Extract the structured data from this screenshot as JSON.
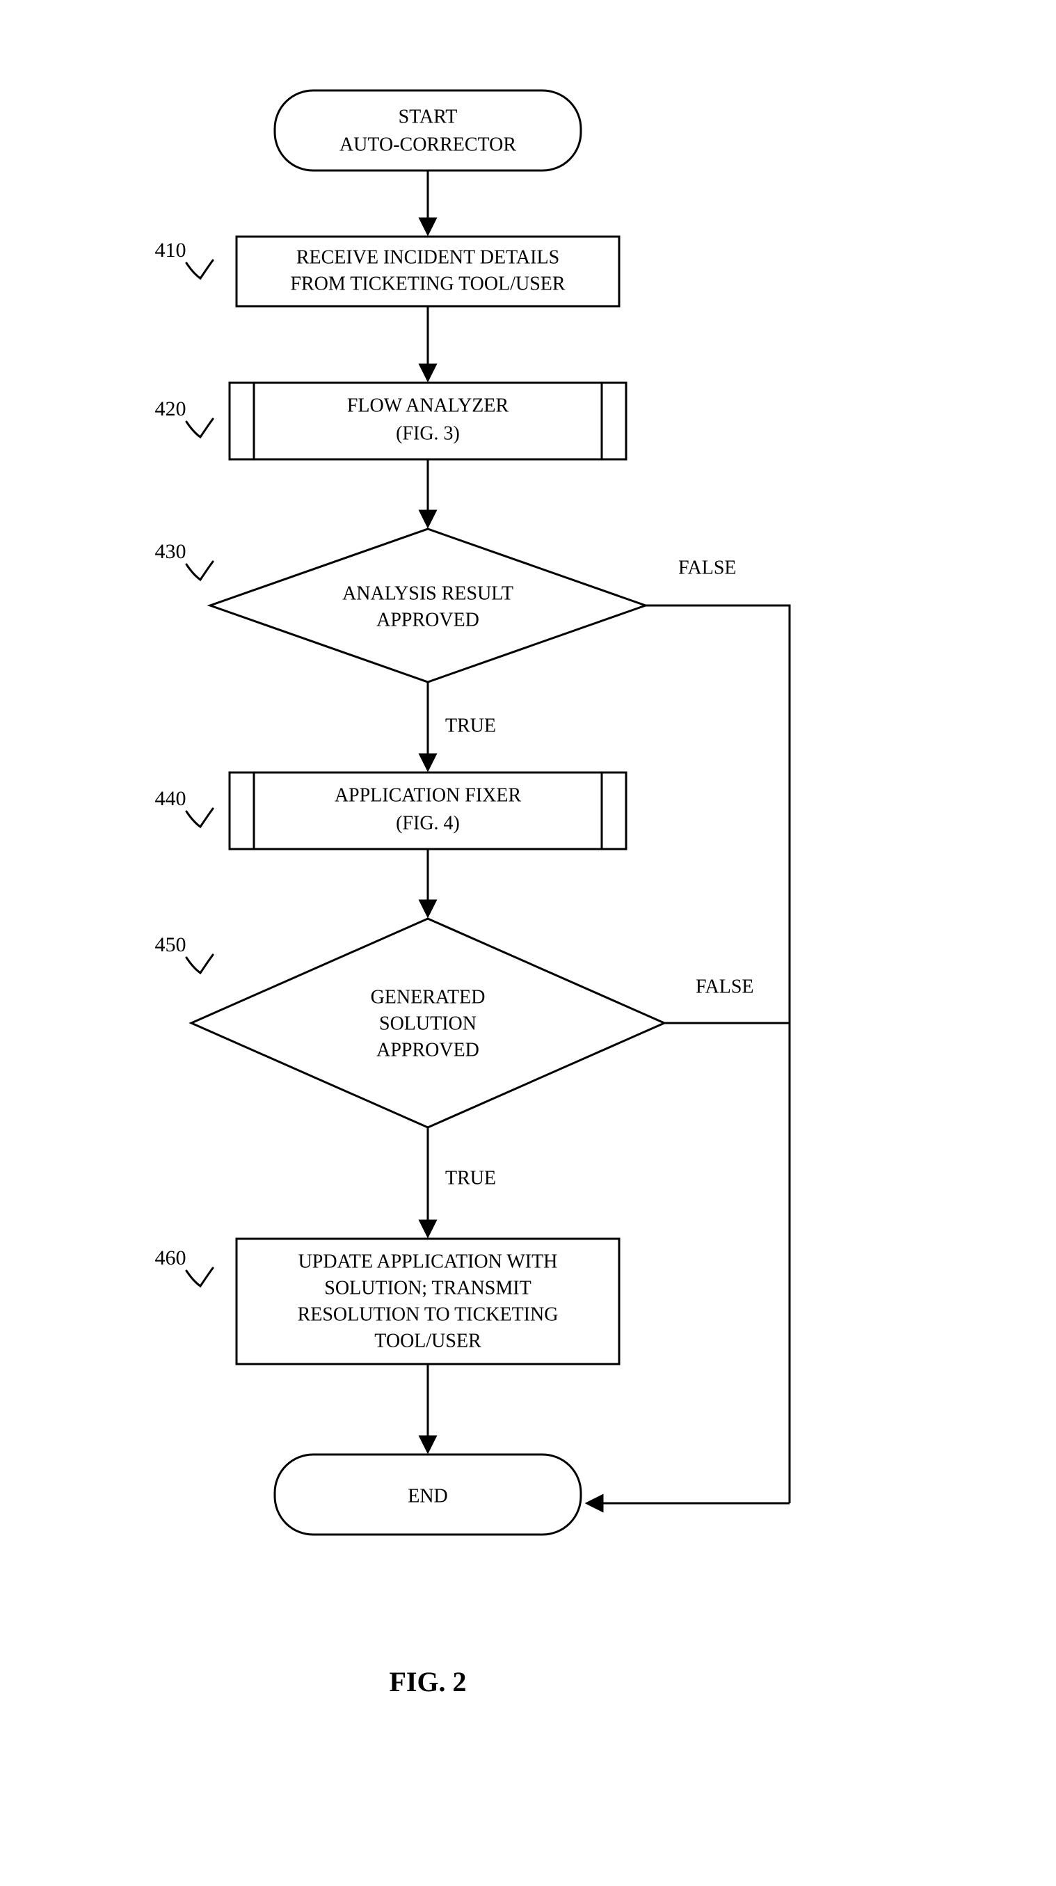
{
  "figure": {
    "caption": "FIG. 2",
    "nodes": {
      "start": {
        "line1": "START",
        "line2": "AUTO-CORRECTOR"
      },
      "n410": {
        "ref": "410",
        "line1": "RECEIVE INCIDENT DETAILS",
        "line2": "FROM TICKETING TOOL/USER"
      },
      "n420": {
        "ref": "420",
        "line1": "FLOW ANALYZER",
        "line2": "(FIG. 3)"
      },
      "n430": {
        "ref": "430",
        "line1": "ANALYSIS RESULT",
        "line2": "APPROVED"
      },
      "n440": {
        "ref": "440",
        "line1": "APPLICATION FIXER",
        "line2": "(FIG. 4)"
      },
      "n450": {
        "ref": "450",
        "line1": "GENERATED",
        "line2": "SOLUTION",
        "line3": "APPROVED"
      },
      "n460": {
        "ref": "460",
        "line1": "UPDATE APPLICATION WITH",
        "line2": "SOLUTION; TRANSMIT",
        "line3": "RESOLUTION TO TICKETING",
        "line4": "TOOL/USER"
      },
      "end": {
        "line1": "END"
      }
    },
    "edges": {
      "true": "TRUE",
      "false": "FALSE"
    }
  }
}
